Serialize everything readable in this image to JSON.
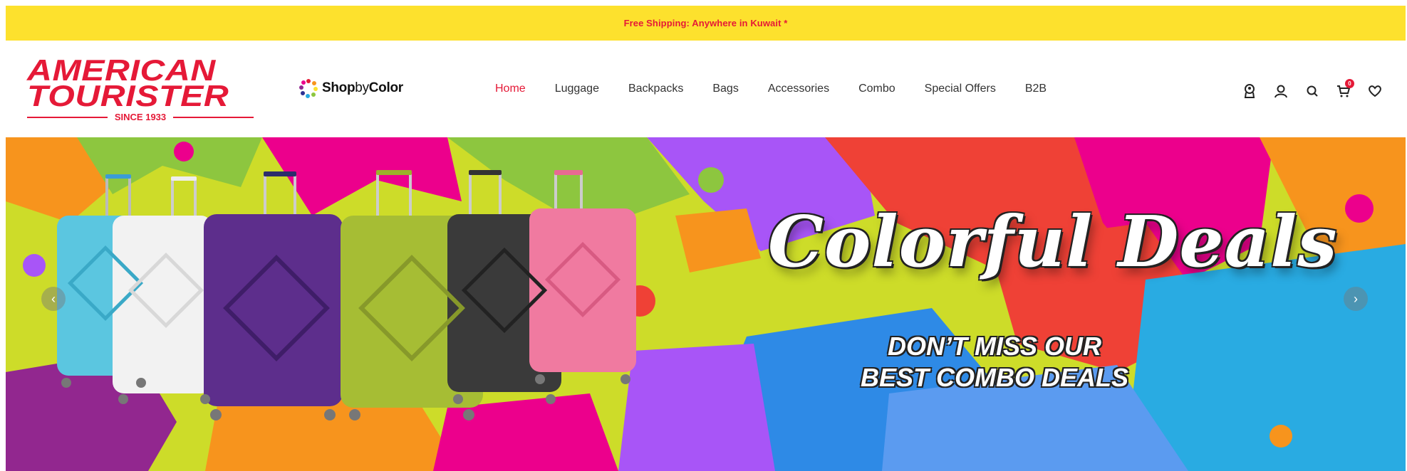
{
  "promo": {
    "text": "Free Shipping: Anywhere in Kuwait *"
  },
  "logo": {
    "line1": "AMERICAN",
    "line2": "TOURISTER",
    "since": "SINCE 1933"
  },
  "shopby": {
    "shop": "Shop",
    "by": "by",
    "color": "Color"
  },
  "nav": {
    "items": [
      {
        "label": "Home",
        "active": true
      },
      {
        "label": "Luggage"
      },
      {
        "label": "Backpacks"
      },
      {
        "label": "Bags"
      },
      {
        "label": "Accessories"
      },
      {
        "label": "Combo"
      },
      {
        "label": "Special Offers"
      },
      {
        "label": "B2B"
      }
    ]
  },
  "icons": {
    "store": "store-locator-icon",
    "account": "user-icon",
    "search": "search-icon",
    "cart": "cart-icon",
    "wishlist": "heart-icon",
    "cart_count": "0"
  },
  "hero": {
    "title": "Colorful Deals",
    "subtitle_line1": "DON’T MISS OUR",
    "subtitle_line2": "BEST COMBO DEALS",
    "prev": "‹",
    "next": "›"
  },
  "colors": {
    "brand": "#e51937",
    "promo_bg": "#fde12d"
  }
}
